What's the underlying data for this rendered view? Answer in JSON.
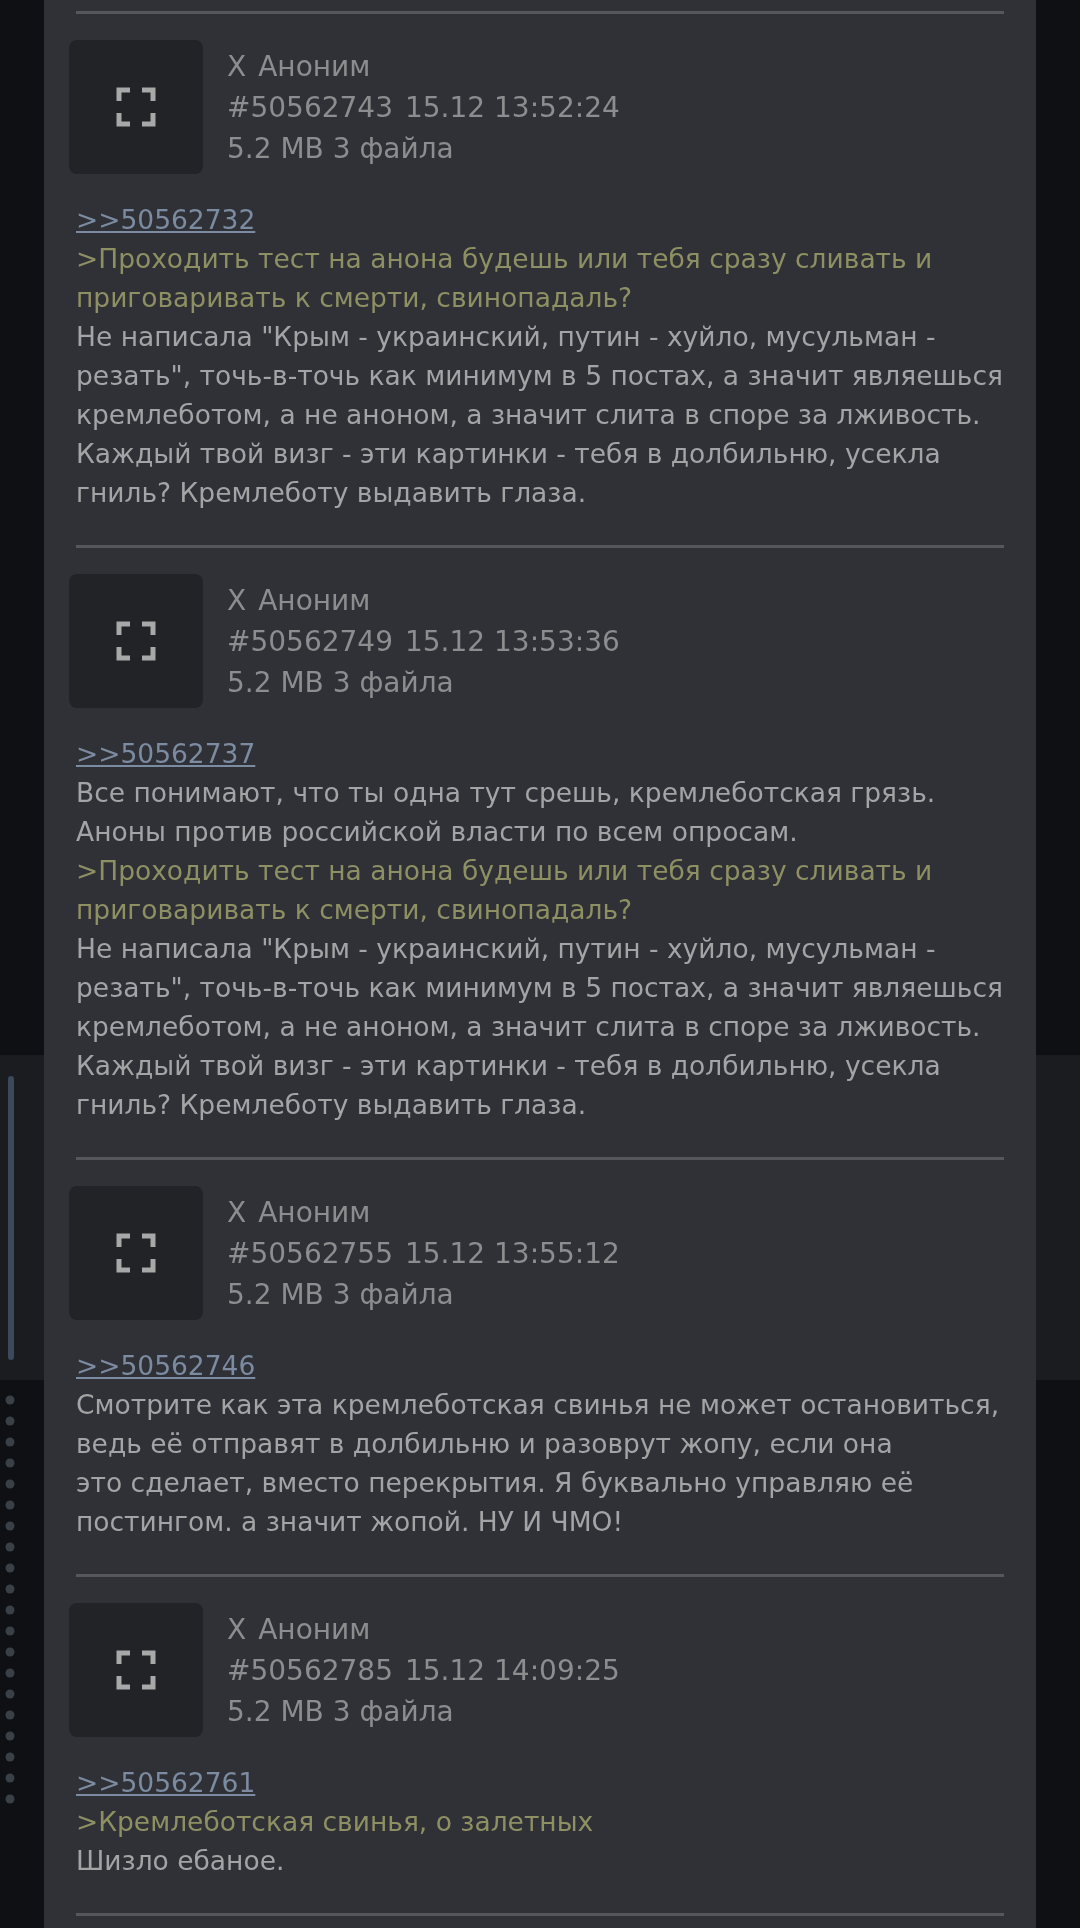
{
  "posts": [
    {
      "name": "Аноним",
      "mark": "X",
      "number": "#50562743",
      "date": "15.12 13:52:24",
      "files": "5.2 MB 3 файла",
      "reply_link": ">>50562732",
      "lines": [
        {
          "kind": "quote",
          "text": ">Проходить тест на анона будешь или тебя сразу сливать и приговаривать к смерти, свинопадаль?"
        },
        {
          "kind": "text",
          "text": "Не написала \"Крым - украинский, путин - хуйло, мусульман - резать\", точь-в-точь как минимум в 5 постах, а значит являешься кремлеботом, а не аноном, а значит слита в споре за лживость. Каждый твой визг - эти картинки - тебя в долбильню, усекла гниль? Кремлеботу выдавить глаза."
        }
      ]
    },
    {
      "name": "Аноним",
      "mark": "X",
      "number": "#50562749",
      "date": "15.12 13:53:36",
      "files": "5.2 MB 3 файла",
      "reply_link": ">>50562737",
      "lines": [
        {
          "kind": "text",
          "text": "Все понимают, что ты одна тут срешь, кремлеботская грязь."
        },
        {
          "kind": "text",
          "text": "Аноны против российской власти по всем опросам."
        },
        {
          "kind": "quote",
          "text": ">Проходить тест на анона будешь или тебя сразу сливать и приговаривать к смерти, свинопадаль?"
        },
        {
          "kind": "text",
          "text": "Не написала \"Крым - украинский, путин - хуйло, мусульман - резать\", точь-в-точь как минимум в 5 постах, а значит являешься кремлеботом, а не аноном, а значит слита в споре за лживость. Каждый твой визг - эти картинки - тебя в долбильню, усекла гниль? Кремлеботу выдавить глаза."
        }
      ]
    },
    {
      "name": "Аноним",
      "mark": "X",
      "number": "#50562755",
      "date": "15.12 13:55:12",
      "files": "5.2 MB 3 файла",
      "reply_link": ">>50562746",
      "lines": [
        {
          "kind": "text",
          "text": "Смотрите как эта кремлеботская свинья не может остановиться, ведь её отправят в долбильню и разоврут жопу, если она"
        },
        {
          "kind": "text",
          "text": "это сделает, вместо перекрытия. Я буквально управляю её постингом. а значит жопой. НУ И ЧМО!"
        }
      ]
    },
    {
      "name": "Аноним",
      "mark": "X",
      "number": "#50562785",
      "date": "15.12 14:09:25",
      "files": "5.2 MB 3 файла",
      "reply_link": ">>50562761",
      "lines": [
        {
          "kind": "quote",
          "text": ">Кремлеботская свинья, о залетных"
        },
        {
          "kind": "text",
          "text": "Шизло ебаное."
        }
      ]
    }
  ]
}
